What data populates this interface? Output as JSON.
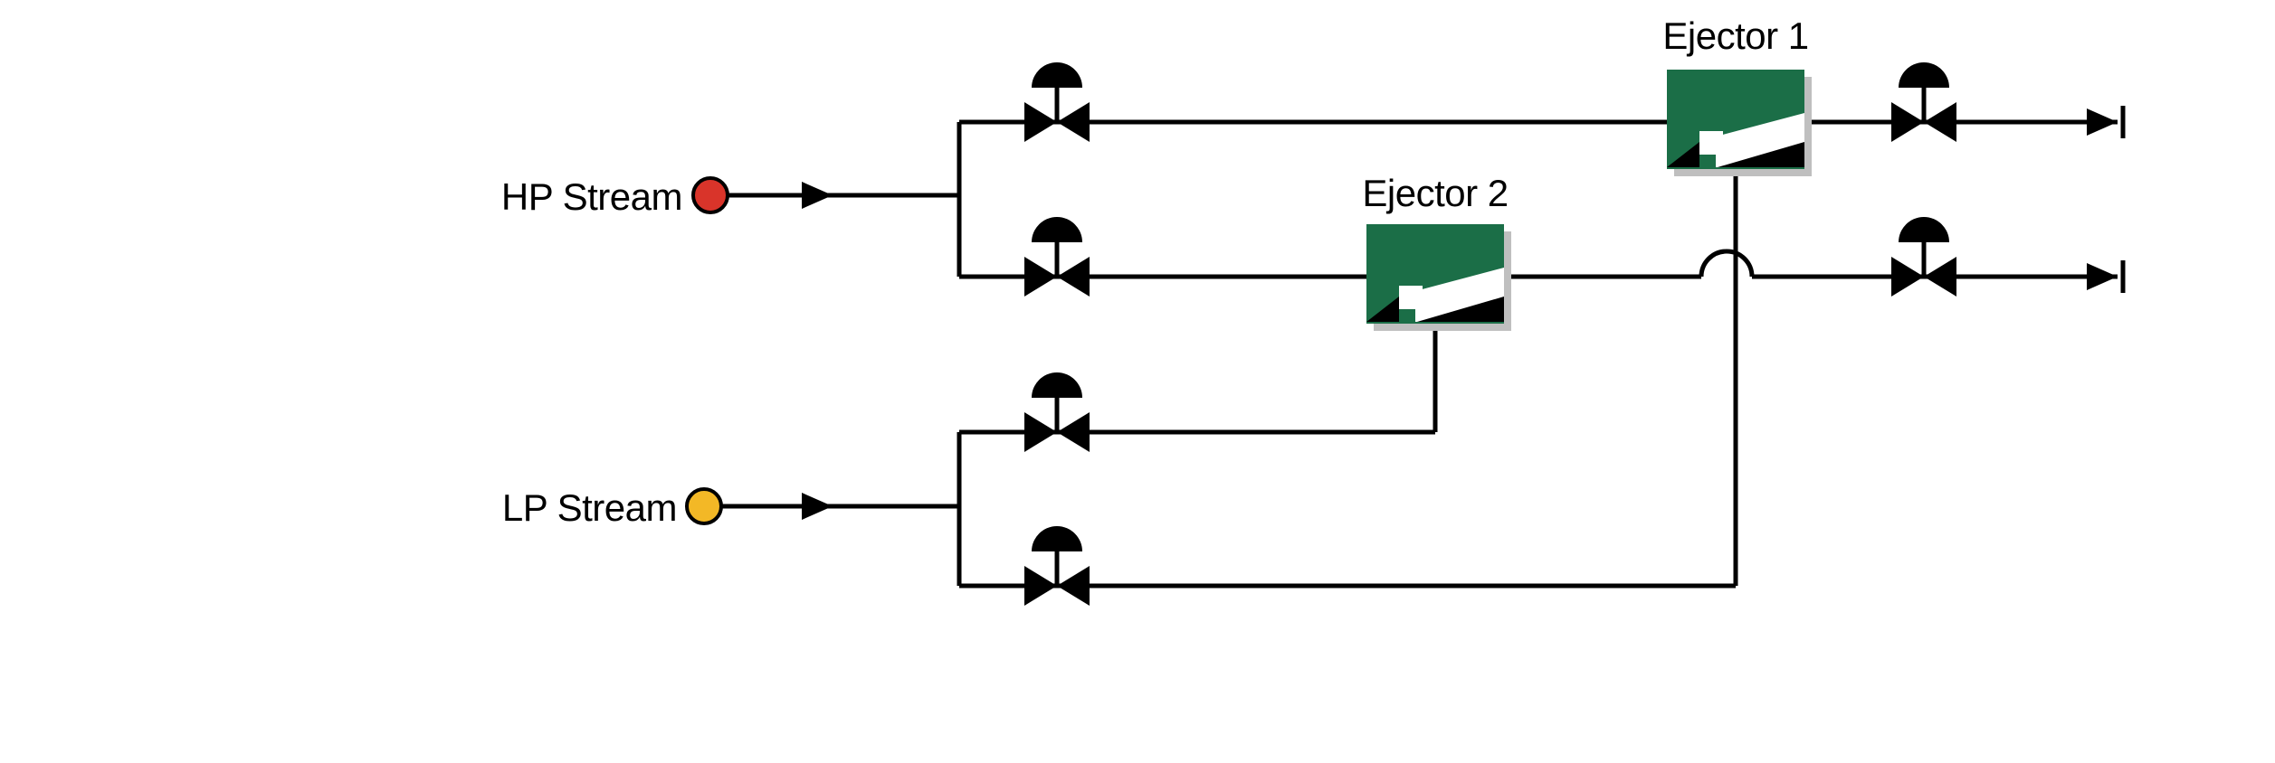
{
  "diagram": {
    "hp_stream_label": "HP Stream",
    "lp_stream_label": "LP Stream",
    "ejector1_label": "Ejector 1",
    "ejector2_label": "Ejector 2",
    "hp_stream_color": "#d9342a",
    "lp_stream_color": "#f3b826",
    "ejector_fill": "#1b6e47",
    "line_color": "#000000"
  }
}
